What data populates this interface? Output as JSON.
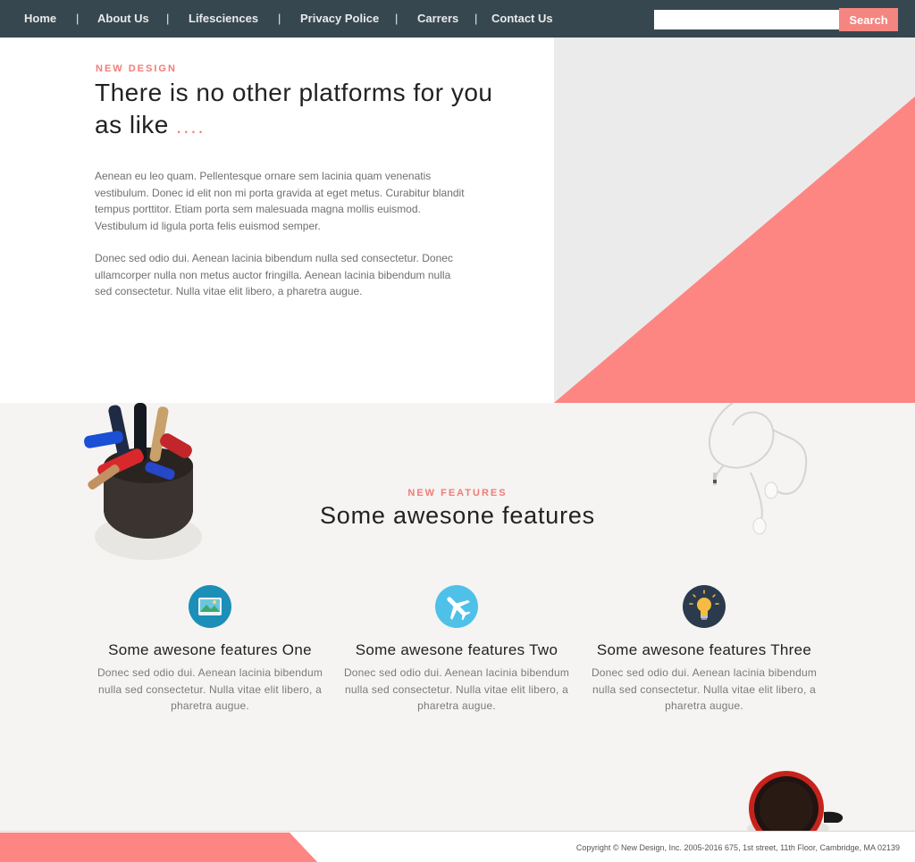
{
  "nav": {
    "items": [
      {
        "label": "Home"
      },
      {
        "label": "About Us"
      },
      {
        "label": "Lifesciences"
      },
      {
        "label": "Privacy Police"
      },
      {
        "label": "Carrers"
      },
      {
        "label": "Contact Us"
      }
    ],
    "separator": "|",
    "search": {
      "value": "",
      "placeholder": "",
      "button_label": "Search"
    }
  },
  "hero": {
    "eyebrow": "NEW DESIGN",
    "title": "There is no other platforms for you as like",
    "title_dots": "....",
    "paragraphs": [
      "Aenean eu leo quam. Pellentesque ornare sem lacinia quam venenatis vestibulum. Donec id elit non mi porta gravida at eget metus. Curabitur blandit tempus porttitor. Etiam porta sem malesuada magna mollis euismod. Vestibulum id ligula porta felis euismod semper.",
      "Donec sed odio dui. Aenean lacinia bibendum nulla sed consectetur. Donec ullamcorper nulla non metus auctor fringilla. Aenean lacinia bibendum nulla sed consectetur. Nulla vitae elit libero, a pharetra augue."
    ]
  },
  "features": {
    "eyebrow": "NEW FEATURES",
    "title": "Some awesone features",
    "items": [
      {
        "icon": "picture-icon",
        "title": "Some awesone features One",
        "desc": "Donec sed odio dui. Aenean lacinia bibendum nulla sed consectetur. Nulla vitae elit libero, a pharetra augue."
      },
      {
        "icon": "airplane-icon",
        "title": "Some awesone features Two",
        "desc": "Donec sed odio dui. Aenean lacinia bibendum nulla sed consectetur. Nulla vitae elit libero, a pharetra augue."
      },
      {
        "icon": "lightbulb-icon",
        "title": "Some awesone features Three",
        "desc": "Donec sed odio dui. Aenean lacinia bibendum nulla sed consectetur. Nulla vitae elit libero, a pharetra augue."
      }
    ]
  },
  "footer": {
    "copyright": "Copyright © New Design, Inc. 2005-2016 675, 1st street, 11th Floor, Cambridge, MA 02139"
  },
  "colors": {
    "accent": "#f48580",
    "nav_bg": "#37474f",
    "hero_right_bg": "#ebebeb",
    "features_bg": "#f5f4f2"
  }
}
